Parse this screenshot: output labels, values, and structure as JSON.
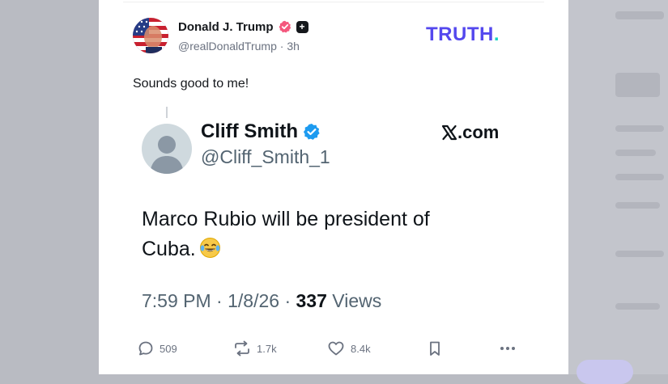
{
  "post": {
    "author_name": "Donald J. Trump",
    "handle": "@realDonaldTrump",
    "separator": "·",
    "age": "3h",
    "text": "Sounds good to me!",
    "plus_badge": "+"
  },
  "brand": {
    "logo_text": "TRUTH",
    "logo_dot": ".",
    "colors": {
      "logo": "#5448ee",
      "logo_dot": "#17d3c0",
      "verified_pink": "#f4577d"
    }
  },
  "embedded": {
    "name": "Cliff Smith",
    "handle": "@Cliff_Smith_1",
    "site": ".com",
    "site_mark": "X",
    "text": "Marco Rubio will be president of Cuba.",
    "emoji": "face-with-tears-of-joy",
    "time": "7:59 PM",
    "dot1": " · ",
    "date": "1/8/26",
    "dot2": " · ",
    "views_count": "337",
    "views_label": " Views",
    "colors": {
      "verified_blue": "#1d9bf0"
    }
  },
  "actions": {
    "replies": "509",
    "retruths": "1.7k",
    "likes": "8.4k",
    "more_icon": "ellipsis-icon",
    "bookmark_icon": "bookmark-icon"
  }
}
